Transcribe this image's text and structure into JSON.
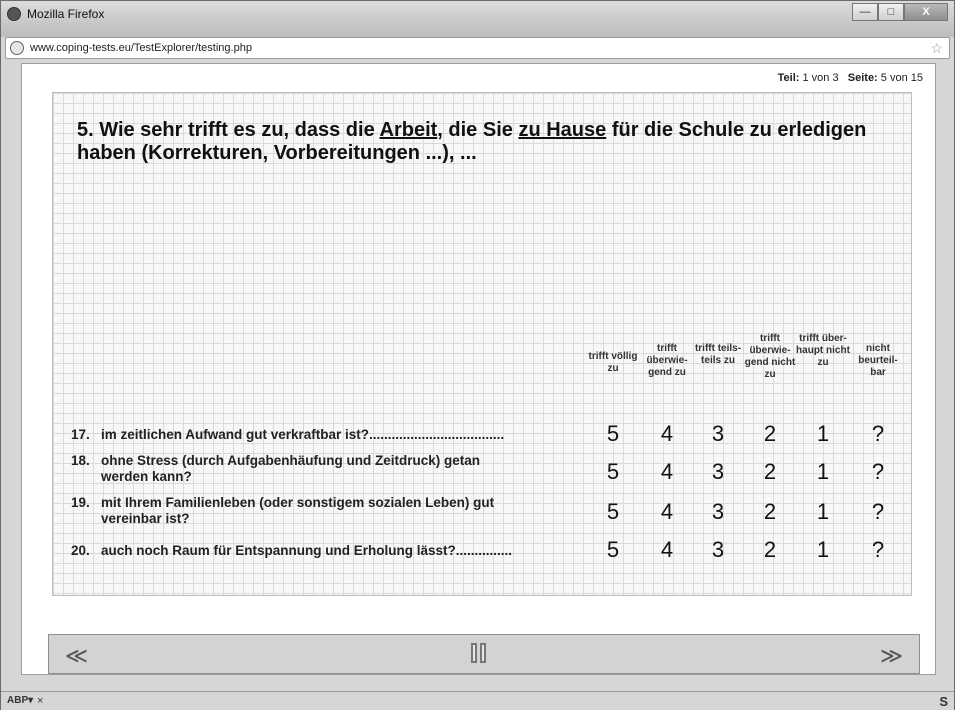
{
  "window": {
    "title": "Mozilla Firefox",
    "url": "www.coping-tests.eu/TestExplorer/testing.php",
    "minimize_glyph": "—",
    "maximize_glyph": "□",
    "close_glyph": "X"
  },
  "page_info": {
    "teil_label": "Teil:",
    "teil_value": "1 von 3",
    "seite_label": "Seite:",
    "seite_value": "5 von 15"
  },
  "question": {
    "prefix": "5. Wie sehr trifft es zu, dass die ",
    "u1": "Arbeit",
    "mid": ", die Sie ",
    "u2": "zu Hause",
    "suffix": " für die Schule zu erledigen haben (Korrekturen, Vorbereitungen ...), ..."
  },
  "columns": [
    "trifft völlig zu",
    "trifft überwie-gend zu",
    "trifft teils-teils zu",
    "trifft überwie-gend nicht zu",
    "trifft über-haupt nicht zu",
    "nicht beurteil-bar"
  ],
  "scale_values": [
    "5",
    "4",
    "3",
    "2",
    "1",
    "?"
  ],
  "items": [
    {
      "num": "17.",
      "line1": "im zeitlichen Aufwand gut verkraftbar ist?....................................",
      "line2": ""
    },
    {
      "num": "18.",
      "line1": "ohne Stress (durch Aufgabenhäufung und Zeitdruck) getan",
      "line2": "werden kann?"
    },
    {
      "num": "19.",
      "line1": "mit Ihrem Familienleben (oder sonstigem sozialen Leben) gut",
      "line2": "vereinbar ist?"
    },
    {
      "num": "20.",
      "line1": "auch noch Raum für Entspannung und Erholung lässt?...............",
      "line2": ""
    }
  ],
  "nav": {
    "prev": "≪",
    "next": "≫"
  },
  "statusbar": {
    "abp": "ABP▾",
    "close": "×",
    "s": "S"
  },
  "icons": {
    "browser": "firefox-icon",
    "url": "globe-icon",
    "bookmark": "star-icon",
    "prev": "prev-arrow-icon",
    "pause": "pause-icon",
    "next": "next-arrow-icon"
  }
}
